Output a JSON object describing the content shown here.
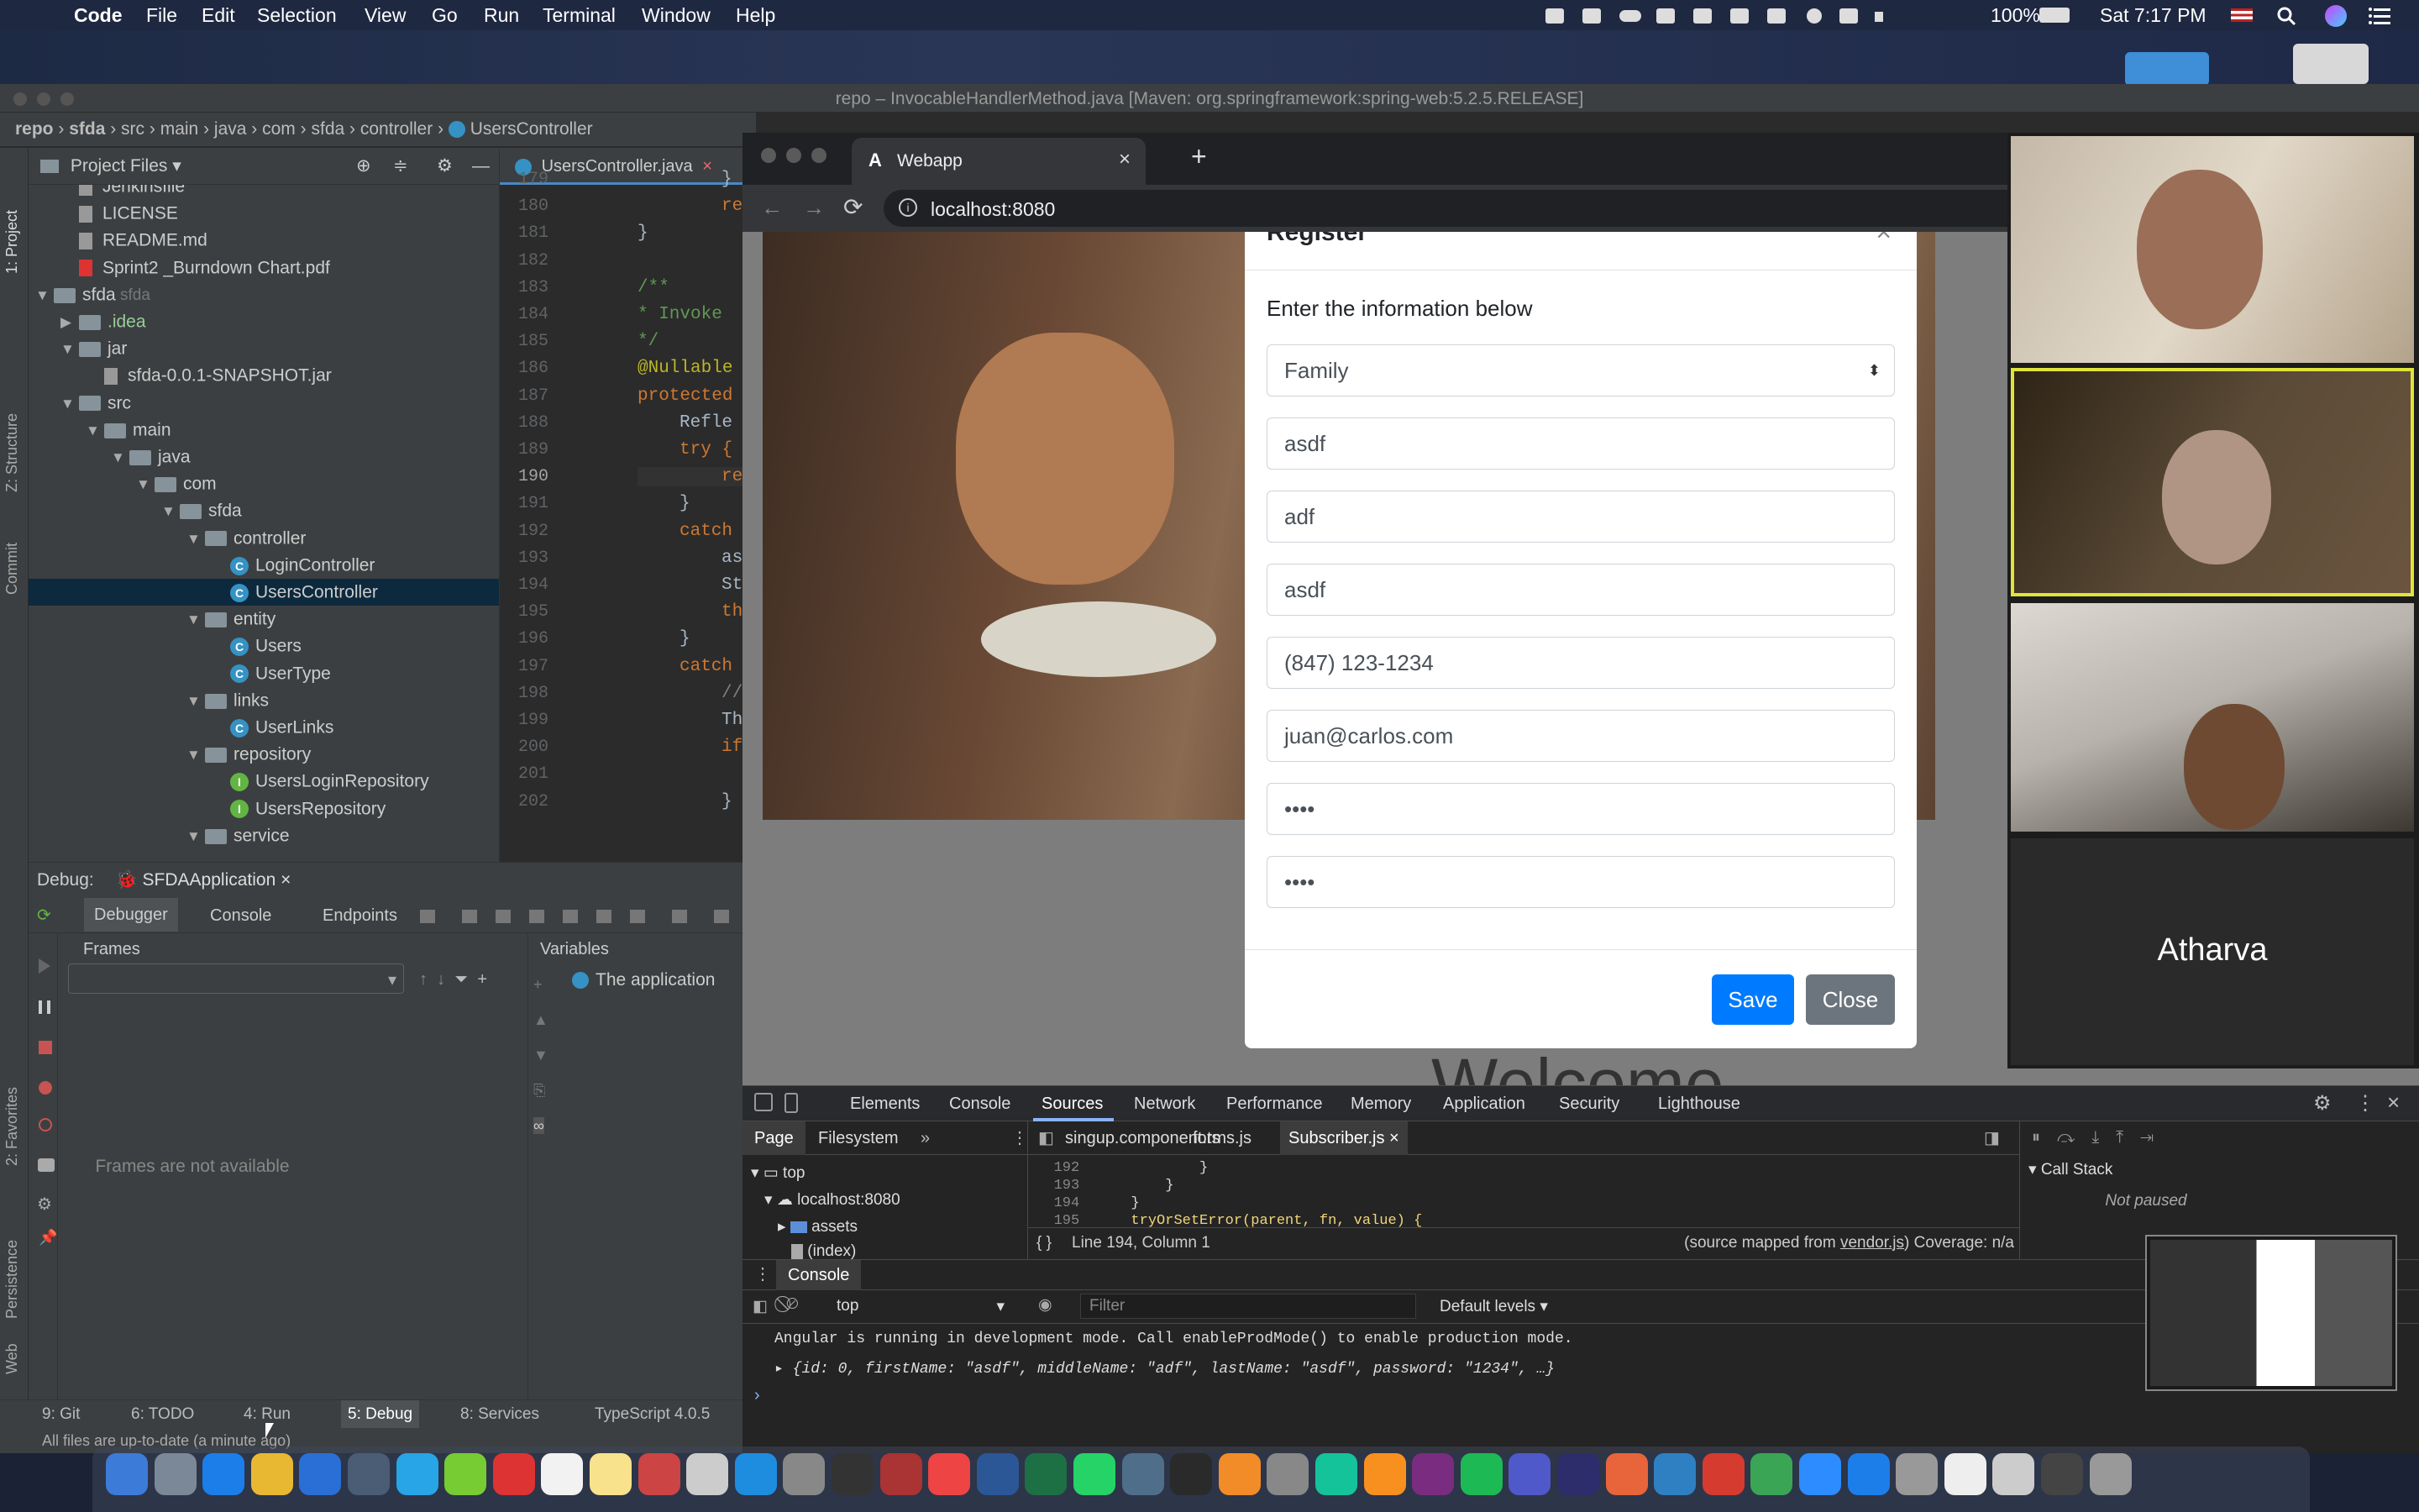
{
  "menubar": {
    "app": "Code",
    "items": [
      "File",
      "Edit",
      "Selection",
      "View",
      "Go",
      "Run",
      "Terminal",
      "Window",
      "Help"
    ],
    "battery": "100%",
    "clock": "Sat 7:17 PM"
  },
  "ide": {
    "title": "repo – InvocableHandlerMethod.java [Maven: org.springframework:spring-web:5.2.5.RELEASE]",
    "breadcrumb": [
      "repo",
      "sfda",
      "src",
      "main",
      "java",
      "com",
      "sfda",
      "controller",
      "UsersController"
    ],
    "project_header": "Project Files",
    "editor_tab": "UsersController.java",
    "side_tabs": [
      "1: Project",
      "Z: Structure",
      "Commit",
      "2: Favorites",
      "Persistence",
      "Web"
    ],
    "tree": [
      {
        "depth": 1,
        "kind": "file",
        "label": "Jenkinsfile"
      },
      {
        "depth": 1,
        "kind": "file",
        "label": "LICENSE"
      },
      {
        "depth": 1,
        "kind": "file",
        "label": "README.md"
      },
      {
        "depth": 1,
        "kind": "pdf",
        "label": "Sprint2 _Burndown Chart.pdf"
      },
      {
        "depth": 0,
        "kind": "folder",
        "arrow": "▼",
        "label": "sfda",
        "sub": "sfda"
      },
      {
        "depth": 1,
        "kind": "folder",
        "arrow": "▶",
        "label": ".idea"
      },
      {
        "depth": 1,
        "kind": "folder",
        "arrow": "▼",
        "label": "jar"
      },
      {
        "depth": 2,
        "kind": "file",
        "label": "sfda-0.0.1-SNAPSHOT.jar"
      },
      {
        "depth": 1,
        "kind": "folder",
        "arrow": "▼",
        "label": "src"
      },
      {
        "depth": 2,
        "kind": "folder",
        "arrow": "▼",
        "label": "main"
      },
      {
        "depth": 3,
        "kind": "folder",
        "arrow": "▼",
        "label": "java"
      },
      {
        "depth": 4,
        "kind": "folder",
        "arrow": "▼",
        "label": "com"
      },
      {
        "depth": 5,
        "kind": "folder",
        "arrow": "▼",
        "label": "sfda"
      },
      {
        "depth": 6,
        "kind": "folder",
        "arrow": "▼",
        "label": "controller"
      },
      {
        "depth": 7,
        "kind": "class",
        "label": "LoginController"
      },
      {
        "depth": 7,
        "kind": "class",
        "label": "UsersController",
        "selected": true
      },
      {
        "depth": 6,
        "kind": "folder",
        "arrow": "▼",
        "label": "entity"
      },
      {
        "depth": 7,
        "kind": "class",
        "label": "Users"
      },
      {
        "depth": 7,
        "kind": "class",
        "label": "UserType"
      },
      {
        "depth": 6,
        "kind": "folder",
        "arrow": "▼",
        "label": "links"
      },
      {
        "depth": 7,
        "kind": "class",
        "label": "UserLinks"
      },
      {
        "depth": 6,
        "kind": "folder",
        "arrow": "▼",
        "label": "repository"
      },
      {
        "depth": 7,
        "kind": "interface",
        "label": "UsersLoginRepository"
      },
      {
        "depth": 7,
        "kind": "interface",
        "label": "UsersRepository"
      },
      {
        "depth": 6,
        "kind": "folder",
        "arrow": "▼",
        "label": "service"
      }
    ],
    "lines": [
      {
        "n": "179",
        "code": "}",
        "color": "#a9b7c6",
        "indent": 2
      },
      {
        "n": "180",
        "code": "retur",
        "color": "#cc7832",
        "indent": 2
      },
      {
        "n": "181",
        "code": "}",
        "color": "#a9b7c6",
        "indent": 0
      },
      {
        "n": "182",
        "code": "",
        "color": "#a9b7c6",
        "indent": 0
      },
      {
        "n": "183",
        "code": "/**",
        "color": "#629755",
        "indent": 0
      },
      {
        "n": "184",
        "code": " * Invoke",
        "color": "#629755",
        "indent": 0
      },
      {
        "n": "185",
        "code": " */",
        "color": "#629755",
        "indent": 0
      },
      {
        "n": "186",
        "code": "@Nullable",
        "color": "#bbb529",
        "indent": 0
      },
      {
        "n": "187",
        "code": "protected",
        "color": "#cc7832",
        "indent": 0
      },
      {
        "n": "188",
        "code": "Refle",
        "color": "#a9b7c6",
        "indent": 1
      },
      {
        "n": "189",
        "code": "try {",
        "color": "#cc7832",
        "indent": 1
      },
      {
        "n": "190",
        "code": "re",
        "color": "#cc7832",
        "indent": 2
      },
      {
        "n": "191",
        "code": "}",
        "color": "#a9b7c6",
        "indent": 1
      },
      {
        "n": "192",
        "code": "catch",
        "color": "#cc7832",
        "indent": 1
      },
      {
        "n": "193",
        "code": "as",
        "color": "#a9b7c6",
        "indent": 2
      },
      {
        "n": "194",
        "code": "St",
        "color": "#a9b7c6",
        "indent": 2
      },
      {
        "n": "195",
        "code": "th",
        "color": "#cc7832",
        "indent": 2
      },
      {
        "n": "196",
        "code": "}",
        "color": "#a9b7c6",
        "indent": 1
      },
      {
        "n": "197",
        "code": "catch",
        "color": "#cc7832",
        "indent": 1
      },
      {
        "n": "198",
        "code": "//",
        "color": "#808080",
        "indent": 2
      },
      {
        "n": "199",
        "code": "Th",
        "color": "#a9b7c6",
        "indent": 2
      },
      {
        "n": "200",
        "code": "if",
        "color": "#cc7832",
        "indent": 2
      },
      {
        "n": "201",
        "code": "",
        "color": "#a9b7c6",
        "indent": 0
      },
      {
        "n": "202",
        "code": "}",
        "color": "#a9b7c6",
        "indent": 2
      }
    ],
    "debug": {
      "label": "Debug:",
      "config": "SFDAApplication",
      "tabs": [
        "Debugger",
        "Console",
        "Endpoints"
      ],
      "frames_title": "Frames",
      "variables_title": "Variables",
      "frames_empty": "Frames are not available",
      "variables_msg": "The application"
    },
    "bottom_tabs": [
      "9: Git",
      "6: TODO",
      "4: Run",
      "5: Debug",
      "8: Services",
      "TypeScript 4.0.5"
    ],
    "status": "All files are up-to-date (a minute ago)"
  },
  "browser": {
    "tab_title": "Webapp",
    "url": "localhost:8080",
    "modal": {
      "title": "Register",
      "subtitle": "Enter the information below",
      "select_value": "Family",
      "fields": [
        "asdf",
        "adf",
        "asdf",
        "(847) 123-1234",
        "juan@carlos.com",
        "••••",
        "••••"
      ],
      "save": "Save",
      "close": "Close"
    },
    "welcome": "Welcome",
    "devtools": {
      "tabs": [
        "Elements",
        "Console",
        "Sources",
        "Network",
        "Performance",
        "Memory",
        "Application",
        "Security",
        "Lighthouse"
      ],
      "active_tab": "Sources",
      "nav_tabs": [
        "Page",
        "Filesystem"
      ],
      "file_tabs": [
        "singup.component.ts",
        "forms.js",
        "Subscriber.js"
      ],
      "tree": [
        "top",
        "localhost:8080",
        "assets",
        "(index)"
      ],
      "code": [
        {
          "n": "192",
          "code": "            }"
        },
        {
          "n": "193",
          "code": "        }"
        },
        {
          "n": "194",
          "code": "    }"
        },
        {
          "n": "195",
          "code": "    tryOrSetError(parent, fn, value) {"
        }
      ],
      "position": "Line 194, Column 1",
      "source_map_prefix": "(source mapped from ",
      "source_map_link": "vendor.js",
      "source_map_suffix": ")  Coverage: n/a",
      "call_stack": "Call Stack",
      "not_paused": "Not paused",
      "console_tab": "Console",
      "context": "top",
      "filter_placeholder": "Filter",
      "levels": "Default levels",
      "log1": "Angular is running in development mode. Call enableProdMode() to enable production mode.",
      "log2": "{id: 0, firstName: \"asdf\", middleName: \"adf\", lastName: \"asdf\", password: \"1234\", …}"
    }
  },
  "video": {
    "name_tile": "Atharva"
  }
}
